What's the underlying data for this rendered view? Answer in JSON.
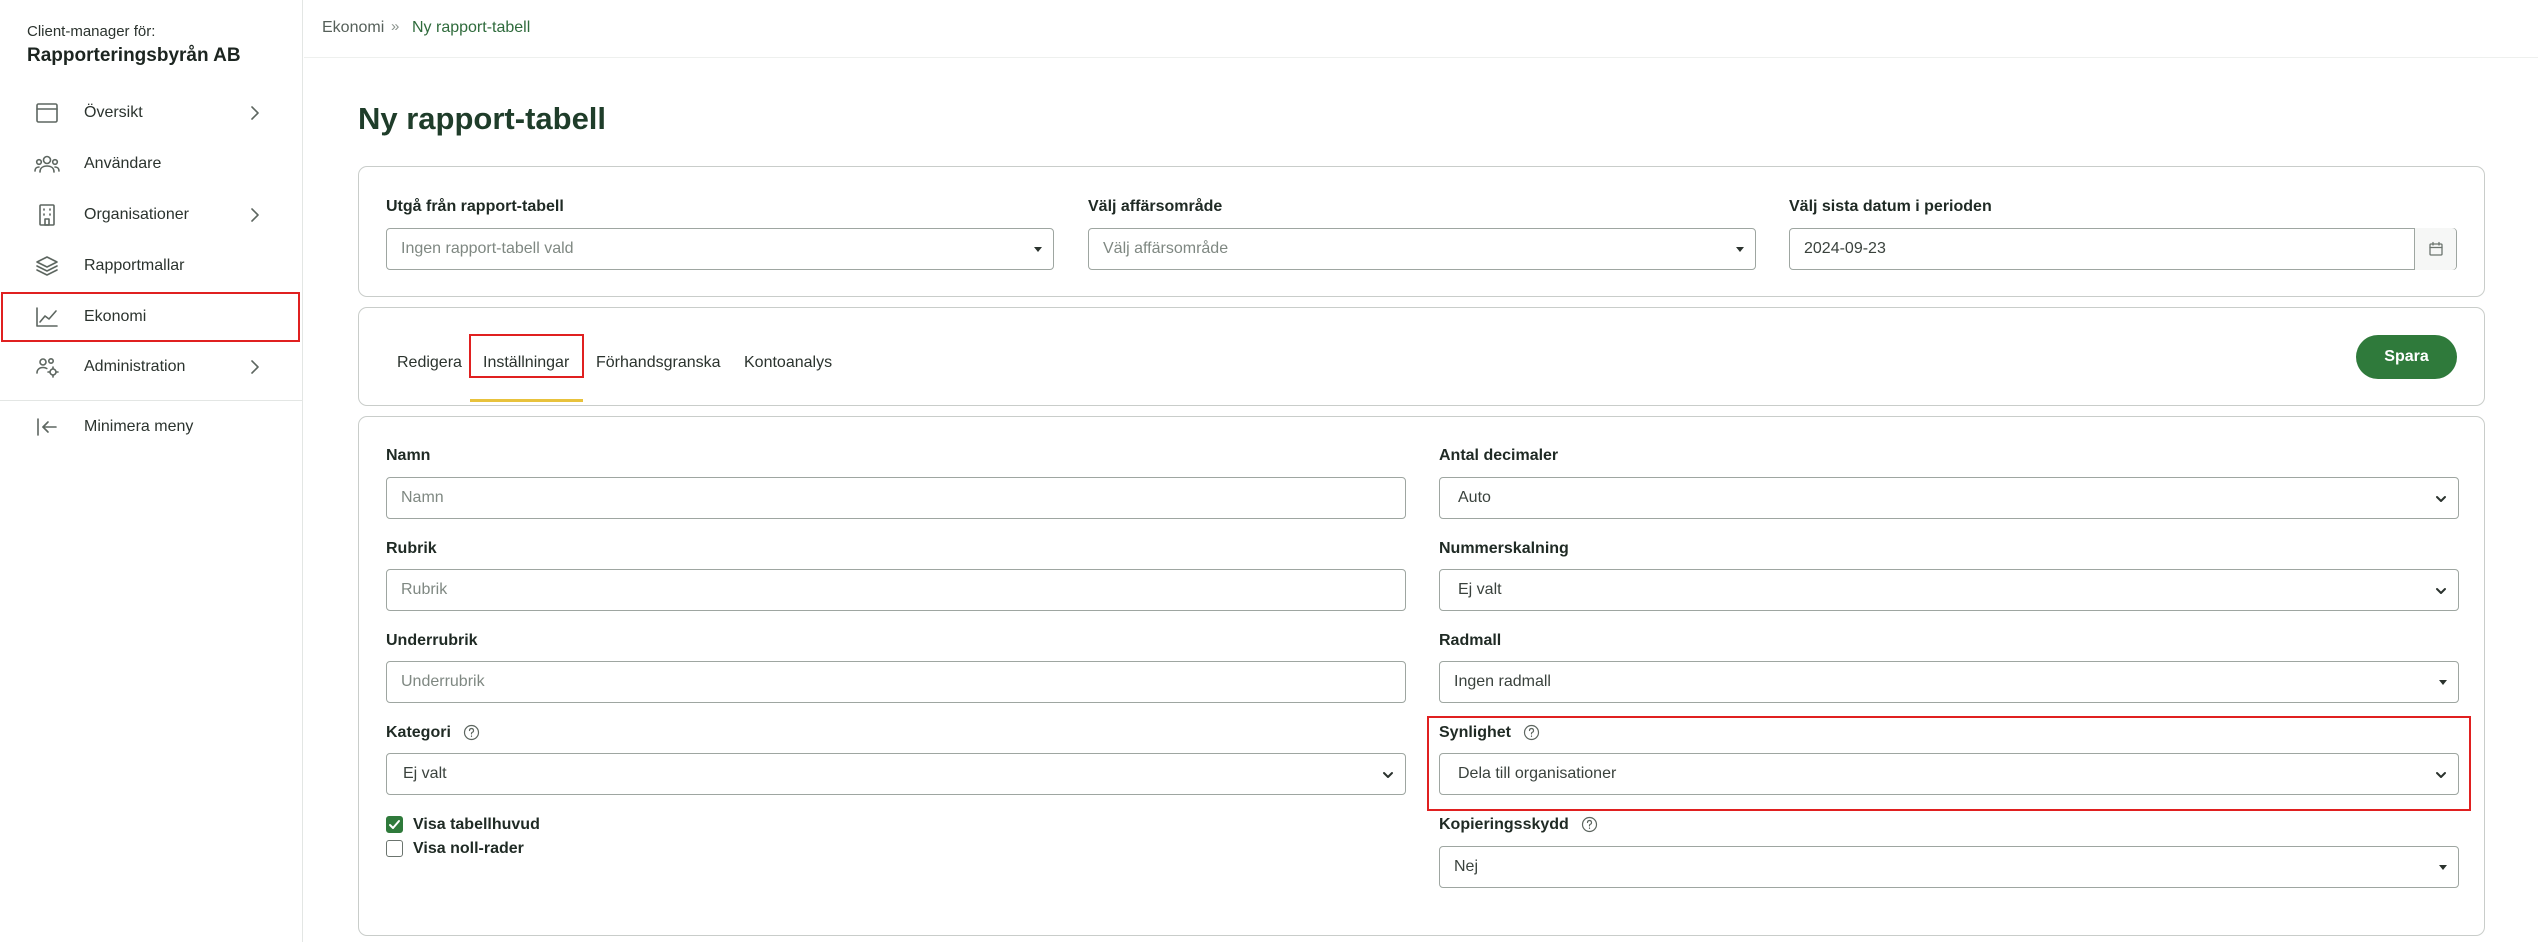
{
  "sidebar": {
    "client_caption": "Client-manager för:",
    "client_name": "Rapporteringsbyrån AB",
    "items": [
      {
        "label": "Översikt",
        "icon": "browser-window-icon",
        "has_submenu": true
      },
      {
        "label": "Användare",
        "icon": "users-icon",
        "has_submenu": false
      },
      {
        "label": "Organisationer",
        "icon": "building-icon",
        "has_submenu": true
      },
      {
        "label": "Rapportmallar",
        "icon": "layers-icon",
        "has_submenu": false
      },
      {
        "label": "Ekonomi",
        "icon": "line-chart-icon",
        "has_submenu": false,
        "highlighted": true
      },
      {
        "label": "Administration",
        "icon": "users-settings-icon",
        "has_submenu": true
      }
    ],
    "minimize_label": "Minimera meny",
    "minimize_icon": "collapse-left-icon"
  },
  "breadcrumb": {
    "items": [
      "Ekonomi",
      "Ny rapport-tabell"
    ],
    "separator": "»"
  },
  "page": {
    "title": "Ny rapport-tabell"
  },
  "top_form": {
    "base_table": {
      "label": "Utgå från rapport-tabell",
      "value": "Ingen rapport-tabell vald"
    },
    "business_area": {
      "label": "Välj affärsområde",
      "value": "Välj affärsområde"
    },
    "period_end": {
      "label": "Välj sista datum i perioden",
      "value": "2024-09-23",
      "icon": "calendar-icon"
    }
  },
  "tabs": {
    "items": [
      "Redigera",
      "Inställningar",
      "Förhandsgranska",
      "Kontoanalys"
    ],
    "active": "Inställningar",
    "save_label": "Spara"
  },
  "settings": {
    "name": {
      "label": "Namn",
      "placeholder": "Namn",
      "value": ""
    },
    "rubrik": {
      "label": "Rubrik",
      "placeholder": "Rubrik",
      "value": ""
    },
    "underrubrik": {
      "label": "Underrubrik",
      "placeholder": "Underrubrik",
      "value": ""
    },
    "kategori": {
      "label": "Kategori",
      "value": "Ej valt",
      "help_icon": "question-circle-icon"
    },
    "visa_tabellhuvud": {
      "label": "Visa tabellhuvud",
      "checked": true
    },
    "visa_noll_rader": {
      "label": "Visa noll-rader",
      "checked": false
    },
    "antal_decimaler": {
      "label": "Antal decimaler",
      "value": "Auto"
    },
    "nummerskalning": {
      "label": "Nummerskalning",
      "value": "Ej valt"
    },
    "radmall": {
      "label": "Radmall",
      "value": "Ingen radmall"
    },
    "synlighet": {
      "label": "Synlighet",
      "value": "Dela till organisationer",
      "help_icon": "question-circle-icon",
      "highlighted": true
    },
    "kopieringsskydd": {
      "label": "Kopieringsskydd",
      "value": "Nej",
      "help_icon": "question-circle-icon"
    }
  },
  "colors": {
    "primary": "#2f7a3b",
    "title": "#1f3d2a",
    "highlight": "#e02020",
    "tab_underline": "#e8c23c"
  }
}
